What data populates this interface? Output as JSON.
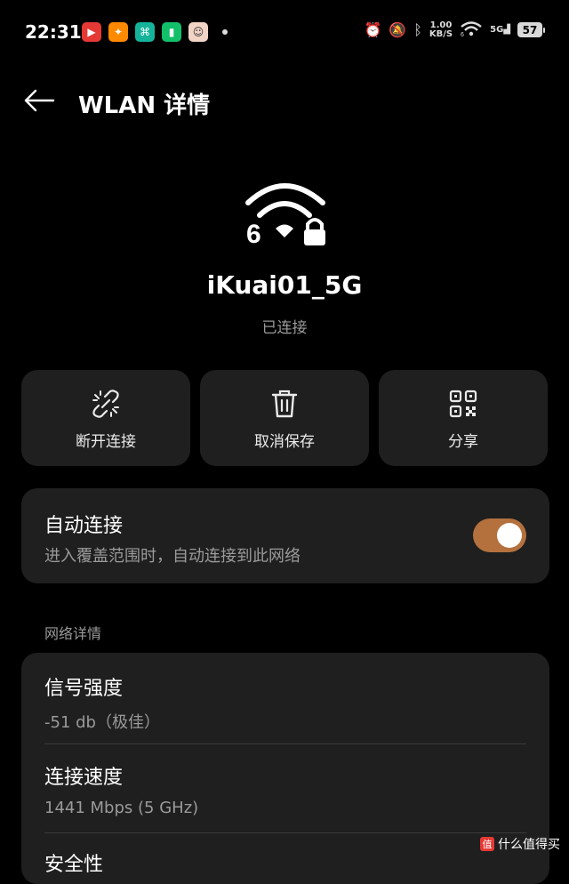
{
  "status_bar": {
    "time": "22:31",
    "net_speed_value": "1.00",
    "net_speed_unit": "KB/S",
    "wifi_badge": "6",
    "cell_type": "5G",
    "battery_level": "57"
  },
  "header": {
    "title": "WLAN 详情"
  },
  "network": {
    "wifi_generation": "6",
    "ssid": "iKuai01_5G",
    "status": "已连接"
  },
  "actions": [
    {
      "label": "断开连接",
      "icon": "unlink-icon"
    },
    {
      "label": "取消保存",
      "icon": "trash-icon"
    },
    {
      "label": "分享",
      "icon": "qr-code-icon"
    }
  ],
  "auto_connect": {
    "title": "自动连接",
    "subtitle": "进入覆盖范围时，自动连接到此网络",
    "enabled": true
  },
  "details": {
    "section_label": "网络详情",
    "rows": [
      {
        "label": "信号强度",
        "value": "-51 db（极佳）"
      },
      {
        "label": "连接速度",
        "value": "1441 Mbps (5 GHz)"
      },
      {
        "label": "安全性",
        "value": ""
      }
    ]
  },
  "watermark": {
    "badge": "值",
    "text": "什么值得买"
  },
  "colors": {
    "background": "#000000",
    "card": "#1f1f1f",
    "toggle_on": "#b4713d",
    "secondary_text": "#9a9a9a"
  }
}
